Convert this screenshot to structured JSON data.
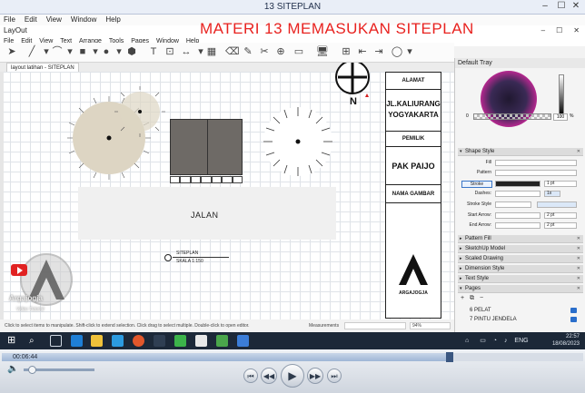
{
  "player": {
    "title": "13 SITEPLAN",
    "menu": [
      "File",
      "Edit",
      "View",
      "Window",
      "Help"
    ],
    "progress": 0.77,
    "current_time": "00:06:44",
    "volume": 0.12,
    "controls": [
      "skip-back",
      "rewind",
      "play",
      "fast-forward",
      "skip-forward"
    ]
  },
  "app": {
    "title": "LayOut",
    "menu": [
      "File",
      "Edit",
      "View",
      "Text",
      "Arrange",
      "Tools",
      "Pages",
      "Window",
      "Help"
    ],
    "document_tab": "layout latihan - SITEPLAN",
    "status_text": "Click to select items to manipulate. Shift-click to extend selection. Click drag to select multiple. Double-click to open editor.",
    "measurements_label": "Measurements",
    "zoom": "94%"
  },
  "overlay_title": "MATERI 13  MEMASUKAN  SITEPLAN",
  "drawing": {
    "north_label": "N",
    "road_label": "JALAN",
    "site_label": "SITEPLAN",
    "scale_label": "SKALA 1:150",
    "info": {
      "alamat_label": "ALAMAT",
      "alamat_value": "JL.KALIURANG YOGYAKARTA",
      "pemilik_label": "PEMILIK",
      "pemilik_value": "PAK PAIJO",
      "nama_gambar_label": "NAMA GAMBAR",
      "logo_text": "ARGAJOGJA"
    }
  },
  "tray": {
    "title": "Default Tray",
    "opacity_min": "0",
    "opacity": "100",
    "opacity_unit": "%",
    "shape_style": {
      "header": "Shape Style",
      "fill": "Fill",
      "pattern": "Pattern",
      "stroke": "Stroke",
      "stroke_width": "1 pt",
      "dashes": "Dashes:",
      "dashes_scale": "1x",
      "stroke_style": "Stroke Style",
      "start_arrow": "Start Arrow:",
      "start_size": "2 pt",
      "end_arrow": "End Arrow:",
      "end_size": "2 pt"
    },
    "sections": [
      "Pattern Fill",
      "SketchUp Model",
      "Scaled Drawing",
      "Dimension Style",
      "Text Style",
      "Pages"
    ],
    "pages": [
      "6  PELAT",
      "7  PINTU JENDELA"
    ]
  },
  "taskbar": {
    "lang": "ENG",
    "time": "22:57",
    "date": "18/08/2023"
  },
  "watermark": {
    "name": "Argajogja",
    "sub": "Video Tutorial"
  },
  "colors": {
    "title_red": "#e8221f",
    "tree_fill": "#ddd5c3",
    "building": "#6e6a66",
    "taskbar": "#1c2838"
  }
}
